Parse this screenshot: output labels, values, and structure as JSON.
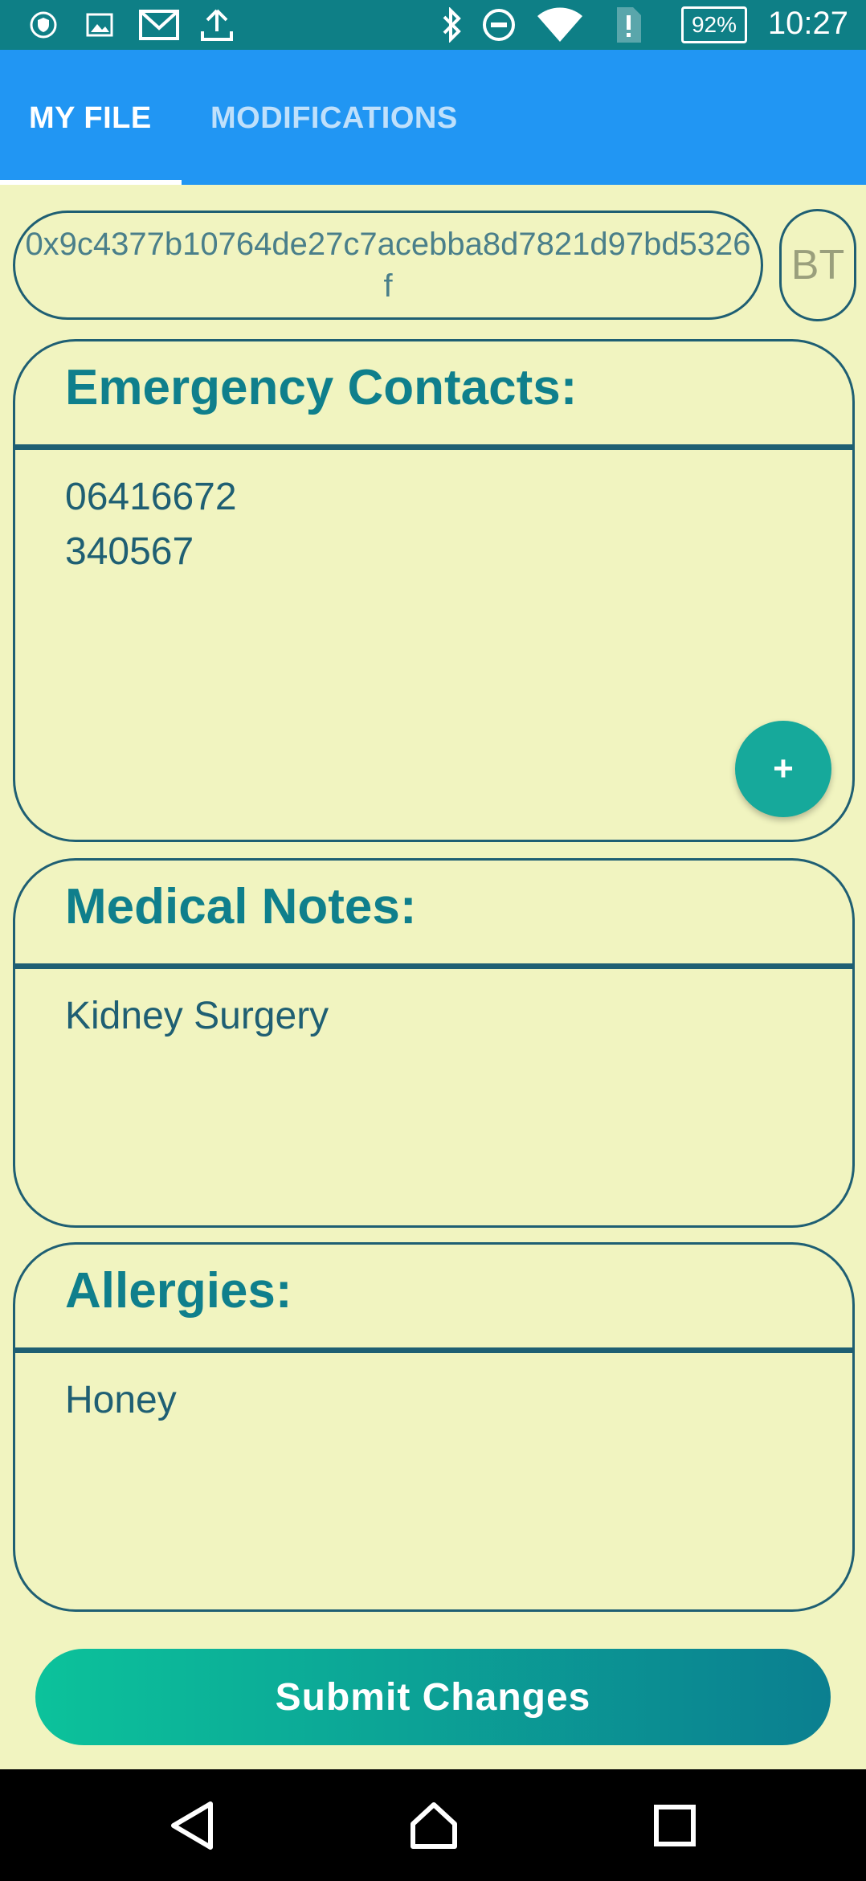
{
  "status_bar": {
    "time": "10:27",
    "battery": "92%",
    "icons": [
      "vpn-icon",
      "image-icon",
      "gmail-icon",
      "upload-icon",
      "bluetooth-icon",
      "dnd-icon",
      "wifi-icon",
      "sim-alert-icon",
      "battery-icon"
    ]
  },
  "tabs": [
    {
      "label": "MY FILE",
      "active": true
    },
    {
      "label": "MODIFICATIONS",
      "active": false
    }
  ],
  "address": "0x9c4377b10764de27c7acebba8d7821d97bd5326f",
  "bt_button": "BT",
  "emergency": {
    "title": "Emergency Contacts:",
    "contacts": [
      "06416672",
      "340567"
    ],
    "add_label": "+"
  },
  "medical": {
    "title": "Medical Notes:",
    "text": "Kidney Surgery"
  },
  "allergies": {
    "title": "Allergies:",
    "text": "Honey"
  },
  "submit_label": "Submit Changes",
  "colors": {
    "status_bar": "#0e7f86",
    "app_bar": "#2196f3",
    "background": "#f1f4c0",
    "accent": "#0f7f8c",
    "border": "#1f5f73"
  }
}
